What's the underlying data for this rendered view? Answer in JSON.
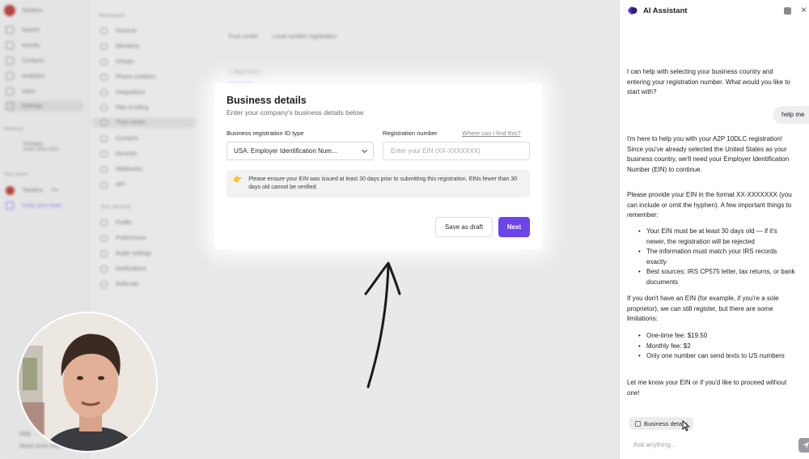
{
  "background_app": {
    "workspace_name": "Tandem",
    "left_nav": [
      "Search",
      "Activity",
      "Contacts",
      "Analytics",
      "Inbox",
      "Settings"
    ],
    "left_section_label": "Network",
    "network_item": "Primary",
    "network_sub": "Active since 2023",
    "your_team_label": "Your team",
    "team_member": "Tandem",
    "team_member_tag": "You",
    "invite_label": "Invite your team",
    "mid_section_workspace": "Workspace",
    "mid_items_workspace": [
      "General",
      "Members",
      "Groups",
      "Phone numbers",
      "Integrations",
      "Plan & billing",
      "Trust center",
      "Contacts",
      "Records",
      "Webhooks",
      "API"
    ],
    "mid_section_personal": "Your account",
    "mid_items_personal": [
      "Profile",
      "Preferences",
      "Audio settings",
      "Notifications",
      "Referrals"
    ],
    "breadcrumb": [
      "Trust center",
      "Local number registration"
    ],
    "step_label": "Step 1 of 4",
    "bottom_items": [
      "Help",
      "Need some help?"
    ]
  },
  "card": {
    "title": "Business details",
    "subtitle": "Enter your company's business details below",
    "id_type_label": "Business registration ID type",
    "id_type_value": "USA: Employer Identification Num...",
    "reg_number_label": "Registration number",
    "where_link": "Where can I find this?",
    "reg_number_placeholder": "Enter your EIN (XX-XXXXXXX)",
    "notice_icon": "👉",
    "notice_text": "Please ensure your EIN was issued at least 30 days prior to submitting this registration. EINs fewer than 30 days old cannot be verified.",
    "save_draft_label": "Save as draft",
    "next_label": "Next"
  },
  "ai_panel": {
    "title": "AI Assistant",
    "close_glyph": "×",
    "msg1": "I can help with selecting your business country and entering your registration number. What would you like to start with?",
    "user_msg": "help me",
    "msg2": "I'm here to help you with your A2P 10DLC registration! Since you've already selected the United States as your business country, we'll need your Employer Identification Number (EIN) to continue.",
    "msg3": "Please provide your EIN in the format XX-XXXXXXX (you can include or omit the hyphen). A few important things to remember:",
    "list1": [
      "Your EIN must be at least 30 days old — if it's newer, the registration will be rejected",
      "The information must match your IRS records exactly",
      "Best sources: IRS CP575 letter, tax returns, or bank documents"
    ],
    "msg4": "If you don't have an EIN (for example, if you're a sole proprietor), we can still register, but there are some limitations:",
    "list2": [
      "One-time fee: $19.50",
      "Monthly fee: $2",
      "Only one number can send texts to US numbers"
    ],
    "msg5": "Let me know your EIN or if you'd like to proceed without one!",
    "chip_label": "Business details",
    "input_placeholder": "Ask anything..."
  },
  "colors": {
    "accent": "#6b44ea",
    "notice_bg": "#f2f2f3"
  }
}
